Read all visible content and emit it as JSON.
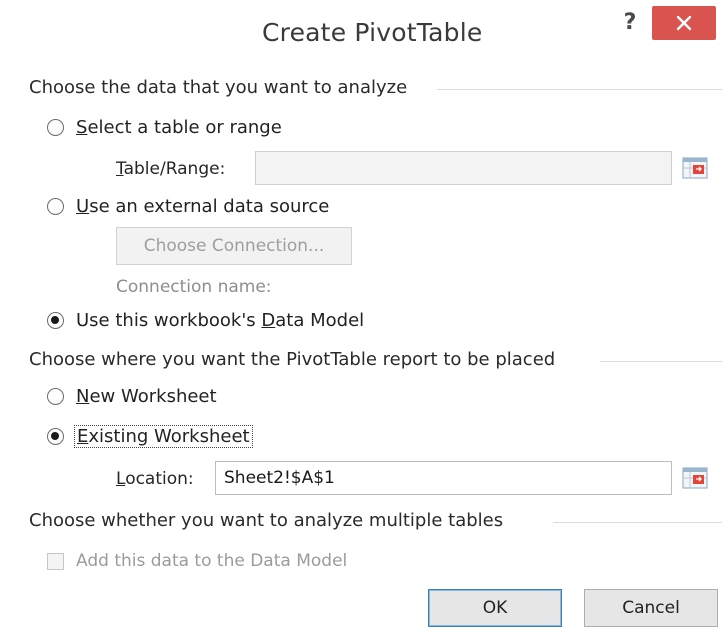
{
  "dialog": {
    "title": "Create PivotTable",
    "help_label": "?"
  },
  "section_analyze": {
    "heading": "Choose the data that you want to analyze",
    "option_table": {
      "underline": "S",
      "rest": "elect a table or range",
      "checked": false
    },
    "table_range_label": {
      "underline": "T",
      "rest": "able/Range:"
    },
    "table_range_value": "",
    "option_external": {
      "underline": "U",
      "rest": "se an external data source",
      "checked": false
    },
    "choose_connection_label": "Choose Connection...",
    "connection_name_label": "Connection name:",
    "option_data_model": {
      "before": "Use this workbook's ",
      "underline": "D",
      "rest": "ata Model",
      "checked": true
    }
  },
  "section_place": {
    "heading": "Choose where you want the PivotTable report to be placed",
    "option_new": {
      "underline": "N",
      "rest": "ew Worksheet",
      "checked": false
    },
    "option_existing": {
      "underline": "E",
      "rest": "xisting Worksheet",
      "checked": true
    },
    "location_label": {
      "underline": "L",
      "rest": "ocation:"
    },
    "location_value": "Sheet2!$A$1"
  },
  "section_multi": {
    "heading": "Choose whether you want to analyze multiple tables",
    "add_to_model_label": "Add this data to the Data Model",
    "add_to_model_checked": false
  },
  "buttons": {
    "ok": "OK",
    "cancel": "Cancel"
  },
  "icons": {
    "close": "close-x-icon",
    "range_picker": "collapse-dialog-icon"
  },
  "colors": {
    "close_button": "#d9534f",
    "default_button_border": "#3c7fb1"
  }
}
